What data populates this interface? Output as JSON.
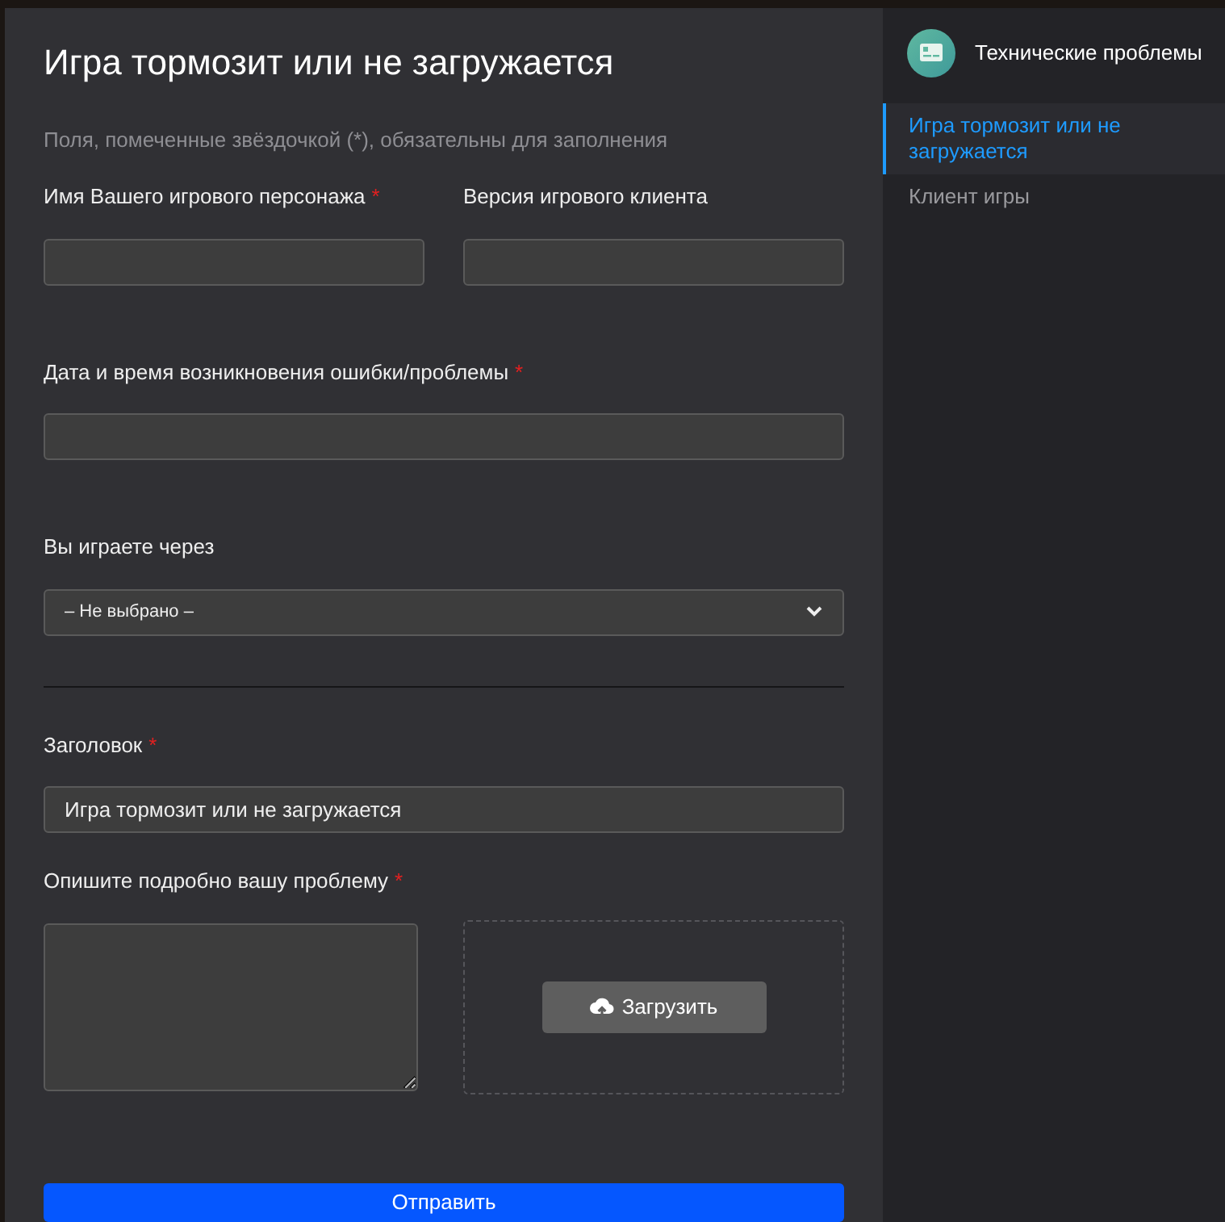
{
  "form": {
    "title": "Игра тормозит или не загружается",
    "note": "Поля, помеченные звёздочкой (*), обязательны для заполнения",
    "row": [
      {
        "label": "Имя Вашего игрового персонажа",
        "required_mark": "*"
      },
      {
        "label": "Версия игрового клиента"
      }
    ],
    "datetime": {
      "label": "Дата и время возникновения ошибки/проблемы",
      "required_mark": "*"
    },
    "platform": {
      "label": "Вы играете через",
      "value": "– Не выбрано –"
    },
    "subject": {
      "label": "Заголовок",
      "required_mark": "*",
      "value": "Игра тормозит или не загружается"
    },
    "description": {
      "label": "Опишите подробно вашу проблему",
      "required_mark": "*"
    },
    "upload_button": "Загрузить",
    "submit_button": "Отправить"
  },
  "sidebar": {
    "title": "Технические проблемы",
    "items": [
      {
        "label": "Игра тормозит или не загружается",
        "selected": true
      },
      {
        "label": "Клиент игры",
        "selected": false
      }
    ]
  }
}
